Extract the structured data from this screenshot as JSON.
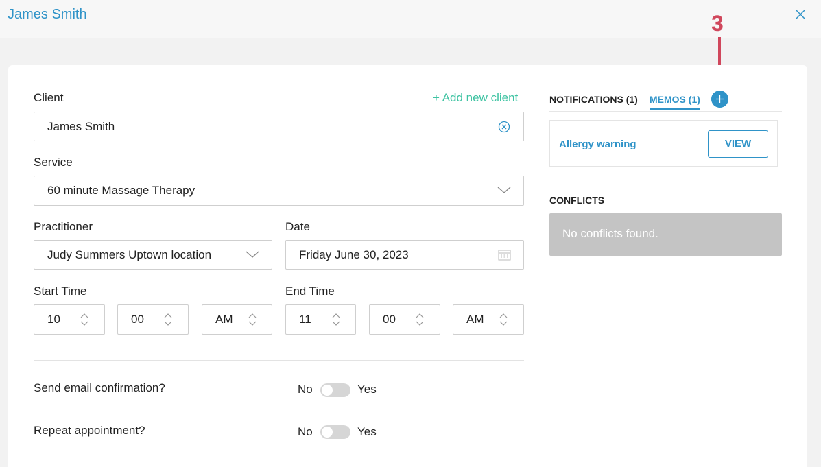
{
  "window": {
    "title": "James Smith"
  },
  "form": {
    "client_label": "Client",
    "add_client": "+ Add new client",
    "client_value": "James Smith",
    "service_label": "Service",
    "service_value": "60 minute Massage Therapy",
    "practitioner_label": "Practitioner",
    "practitioner_value": "Judy Summers Uptown location",
    "date_label": "Date",
    "date_value": "Friday June 30, 2023",
    "start_label": "Start Time",
    "end_label": "End Time",
    "start_hour": "10",
    "start_min": "00",
    "start_ampm": "AM",
    "end_hour": "11",
    "end_min": "00",
    "end_ampm": "AM",
    "email_label": "Send email confirmation?",
    "repeat_label": "Repeat appointment?",
    "no": "No",
    "yes": "Yes"
  },
  "side": {
    "tab_notifications": "NOTIFICATIONS (1)",
    "tab_memos": "MEMOS (1)",
    "memo_label": "Allergy warning",
    "view_button": "VIEW",
    "conflicts_heading": "CONFLICTS",
    "conflicts_text": "No conflicts found."
  },
  "annotation": {
    "number": "3",
    "color": "#d0475c"
  },
  "colors": {
    "accent": "#2f93c8",
    "green": "#3ec3a2"
  },
  "toggles": {
    "email_on": false,
    "repeat_on": false
  }
}
